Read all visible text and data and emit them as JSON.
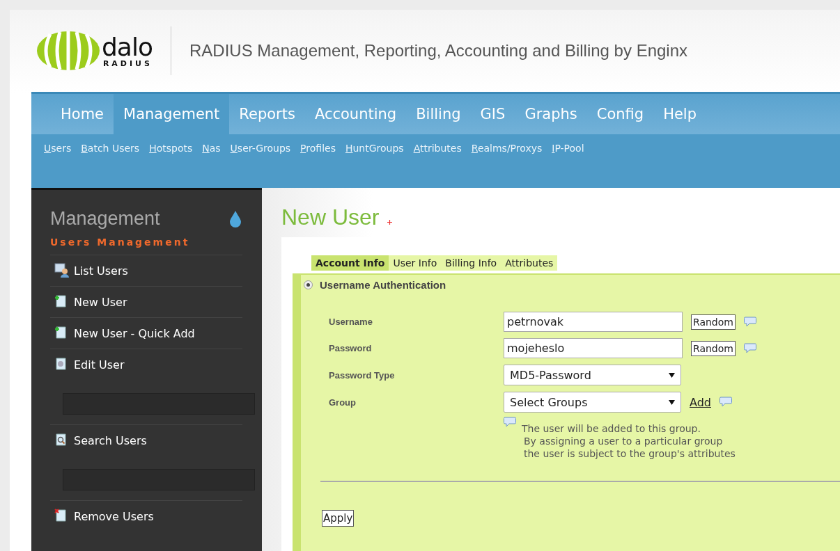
{
  "logo": {
    "name": "dalo",
    "sub": "RADIUS"
  },
  "tagline": "RADIUS Management, Reporting, Accounting and Billing by Enginx",
  "main_menu": [
    {
      "label": "Home",
      "selected": false
    },
    {
      "label": "Management",
      "selected": true
    },
    {
      "label": "Reports",
      "selected": false
    },
    {
      "label": "Accounting",
      "selected": false
    },
    {
      "label": "Billing",
      "selected": false
    },
    {
      "label": "GIS",
      "selected": false
    },
    {
      "label": "Graphs",
      "selected": false
    },
    {
      "label": "Config",
      "selected": false
    },
    {
      "label": "Help",
      "selected": false
    }
  ],
  "sub_menu": [
    "Users",
    "Batch Users",
    "Hotspots",
    "Nas",
    "User-Groups",
    "Profiles",
    "HuntGroups",
    "Attributes",
    "Realms/Proxys",
    "IP-Pool"
  ],
  "sidebar": {
    "title": "Management",
    "section": "Users Management",
    "items": [
      {
        "label": "List Users",
        "kind": "list",
        "has_field": false
      },
      {
        "label": "New User",
        "kind": "new",
        "has_field": false
      },
      {
        "label": "New User - Quick Add",
        "kind": "new",
        "has_field": false
      },
      {
        "label": "Edit User",
        "kind": "edit",
        "has_field": true
      },
      {
        "label": "Search Users",
        "kind": "search",
        "has_field": true
      },
      {
        "label": "Remove Users",
        "kind": "remove",
        "has_field": false
      }
    ]
  },
  "page_title": "New User",
  "tabs": [
    {
      "label": "Account Info",
      "selected": true
    },
    {
      "label": "User Info",
      "selected": false
    },
    {
      "label": "Billing Info",
      "selected": false
    },
    {
      "label": "Attributes",
      "selected": false
    }
  ],
  "auth": {
    "label": "Username Authentication",
    "selected": true
  },
  "fields": [
    {
      "kind": "text",
      "label": "Username",
      "value": "petrnovak",
      "button": "Random"
    },
    {
      "kind": "text",
      "label": "Password",
      "value": "mojeheslo",
      "button": "Random"
    },
    {
      "kind": "select",
      "label": "Password Type",
      "value": "MD5-Password"
    },
    {
      "kind": "select",
      "label": "Group",
      "value": "Select Groups",
      "link": "Add"
    }
  ],
  "group_help": [
    "The user will be added to this group.",
    "By assigning a user to a particular group",
    "the user is subject to the group's attributes"
  ],
  "apply": "Apply"
}
